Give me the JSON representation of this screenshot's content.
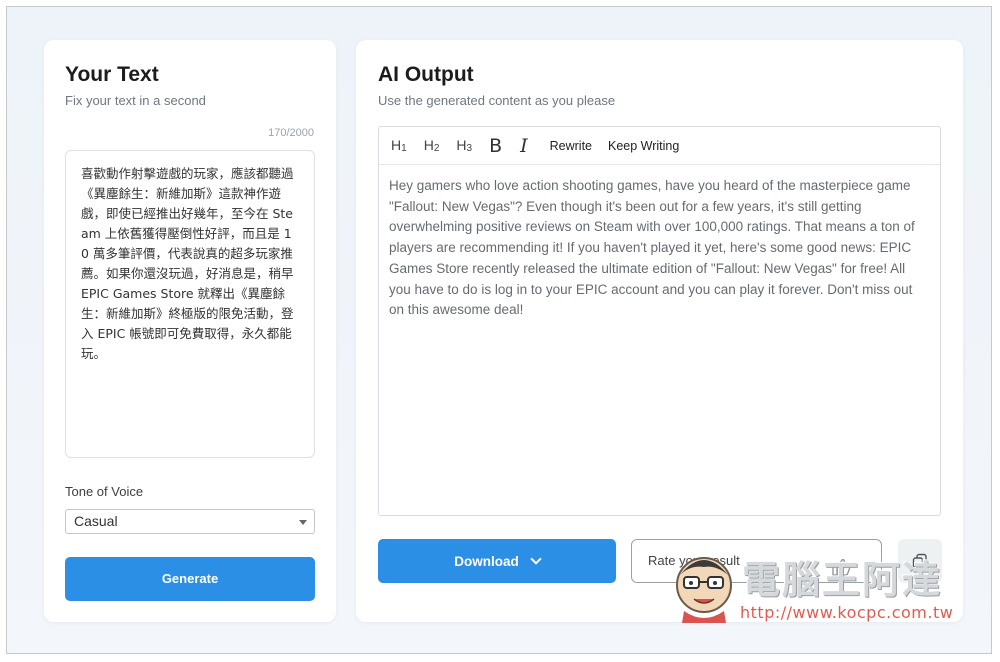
{
  "left_panel": {
    "title": "Your Text",
    "subtitle": "Fix your text in a second",
    "char_counter": "170/2000",
    "input_text": "喜歡動作射擊遊戲的玩家，應該都聽過《異塵餘生：新維加斯》這款神作遊戲，即使已經推出好幾年，至今在 Steam 上依舊獲得壓倒性好評，而且是 10 萬多筆評價，代表說真的超多玩家推薦。如果你還沒玩過，好消息是，稍早 EPIC Games Store 就釋出《異塵餘生：新維加斯》終極版的限免活動，登入 EPIC 帳號即可免費取得，永久都能玩。",
    "tone_label": "Tone of Voice",
    "tone_value": "Casual",
    "generate_label": "Generate"
  },
  "right_panel": {
    "title": "AI Output",
    "subtitle": "Use the generated content as you please",
    "toolbar": {
      "h1": "H",
      "h1_sub": "1",
      "h2": "H",
      "h2_sub": "2",
      "h3": "H",
      "h3_sub": "3",
      "bold": "B",
      "italic": "I",
      "rewrite": "Rewrite",
      "keep_writing": "Keep Writing"
    },
    "output_text": "Hey gamers who love action shooting games, have you heard of the masterpiece game \"Fallout: New Vegas\"? Even though it's been out for a few years, it's still getting overwhelming positive reviews on Steam with over 100,000 ratings. That means a ton of players are recommending it! If you haven't played it yet, here's some good news: EPIC Games Store recently released the ultimate edition of \"Fallout: New Vegas\" for free! All you have to do is log in to your EPIC account and you can play it forever. Don't miss out on this awesome deal!",
    "download_label": "Download",
    "rate_label": "Rate your result"
  },
  "watermark": {
    "title": "電腦王阿達",
    "url": "http://www.kocpc.com.tw"
  },
  "colors": {
    "accent": "#2b8fe6",
    "background": "#eef3f9",
    "watermark_url": "#e25b4f"
  }
}
